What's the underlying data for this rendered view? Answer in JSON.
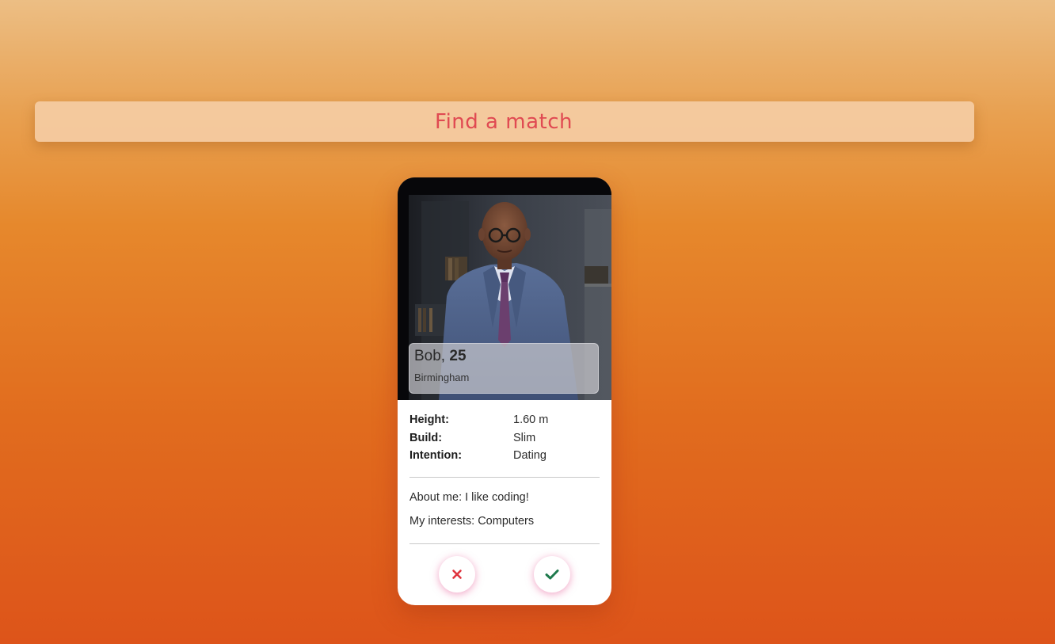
{
  "header": {
    "title": "Find a match"
  },
  "profile": {
    "name": "Bob,",
    "age": "25",
    "city": "Birmingham",
    "details": [
      {
        "label": "Height:",
        "value": "1.60 m"
      },
      {
        "label": "Build:",
        "value": "Slim"
      },
      {
        "label": "Intention:",
        "value": "Dating"
      }
    ],
    "about": "About me: I like coding!",
    "interests": "My interests: Computers"
  },
  "actions": {
    "reject_icon": "close-icon",
    "accept_icon": "check-icon"
  },
  "colors": {
    "title": "#e04a52",
    "reject": "#e0353f",
    "accept": "#1f7a4d"
  }
}
